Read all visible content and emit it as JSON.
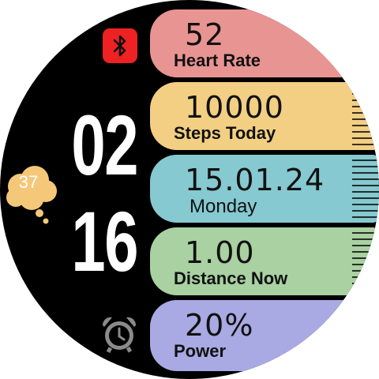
{
  "time": {
    "hour": "02",
    "minute": "16"
  },
  "weather": {
    "temperature": "37",
    "icon": "cloud-icon"
  },
  "status": {
    "bluetooth_icon": "bluetooth-icon",
    "alarm_icon": "alarm-clock-icon"
  },
  "heart": {
    "value": "52",
    "label": "Heart Rate",
    "color": "#e89492"
  },
  "steps": {
    "value": "10000",
    "label": "Steps Today",
    "color": "#f3cf83"
  },
  "date": {
    "value": "15.01.24",
    "label": "Monday",
    "color": "#86c9d0"
  },
  "distance": {
    "value": "1.00",
    "label": "Distance Now",
    "color": "#a9d1a1"
  },
  "power": {
    "value": "20%",
    "label": "Power",
    "color": "#a9a9e3"
  }
}
